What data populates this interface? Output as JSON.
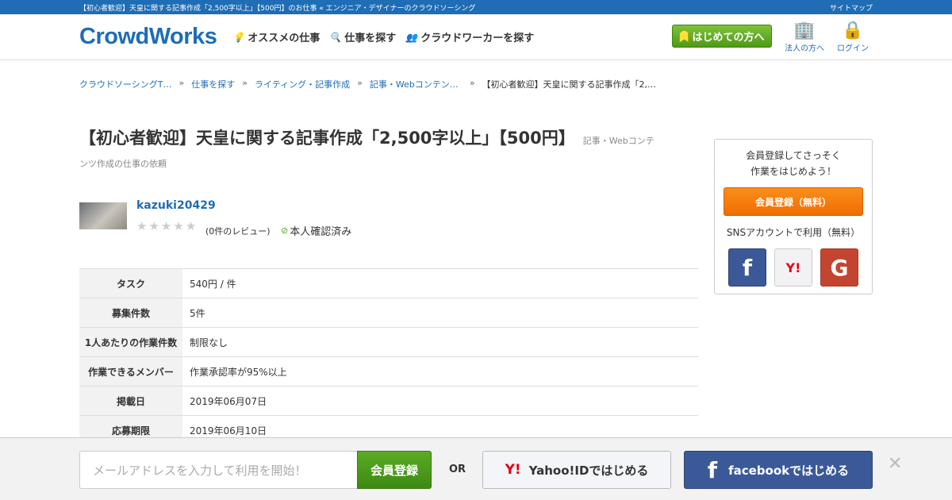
{
  "topbar": {
    "page_title": "【初心者歓迎】天皇に関する記事作成「2,500字以上」【500円】のお仕事 « エンジニア・デザイナーのクラウドソーシング",
    "sitemap": "サイトマップ"
  },
  "header": {
    "logo": "CrowdWorks",
    "nav": [
      "オススメの仕事",
      "仕事を探す",
      "クラウドワーカーを探す"
    ],
    "beginner": "はじめての方へ",
    "corporate": "法人の方へ",
    "login": "ログイン"
  },
  "breadcrumb": [
    "クラウドソーシングT…",
    "仕事を探す",
    "ライティング・記事作成",
    "記事・Webコンテン…",
    "【初心者歓迎】天皇に関する記事作成「2,…"
  ],
  "job": {
    "title": "【初心者歓迎】天皇に関する記事作成「2,500字以上」【500円】",
    "category": "記事・Webコンテ",
    "category_cont": "ンツ作成の仕事の依頼"
  },
  "client": {
    "name": "kazuki20429",
    "rating": 0,
    "reviews": "(0件のレビュー)",
    "verified": "本人確認済み"
  },
  "details": [
    {
      "label": "タスク",
      "value": "540円 / 件"
    },
    {
      "label": "募集件数",
      "value": "5件"
    },
    {
      "label": "1人あたりの作業件数",
      "value": "制限なし"
    },
    {
      "label": "作業できるメンバー",
      "value": "作業承認率が95%以上"
    },
    {
      "label": "掲載日",
      "value": "2019年06月07日"
    },
    {
      "label": "応募期限",
      "value": "2019年06月10日"
    }
  ],
  "sidebar": {
    "msg1": "会員登録してさっそく",
    "msg2": "作業をはじめよう！",
    "register": "会員登録（無料）",
    "sns": "SNSアカウントで利用（無料）"
  },
  "footer": {
    "email_placeholder": "メールアドレスを入力して利用を開始！",
    "register": "会員登録",
    "or": "OR",
    "yahoo": "Yahoo!IDではじめる",
    "facebook": "facebookではじめる"
  }
}
